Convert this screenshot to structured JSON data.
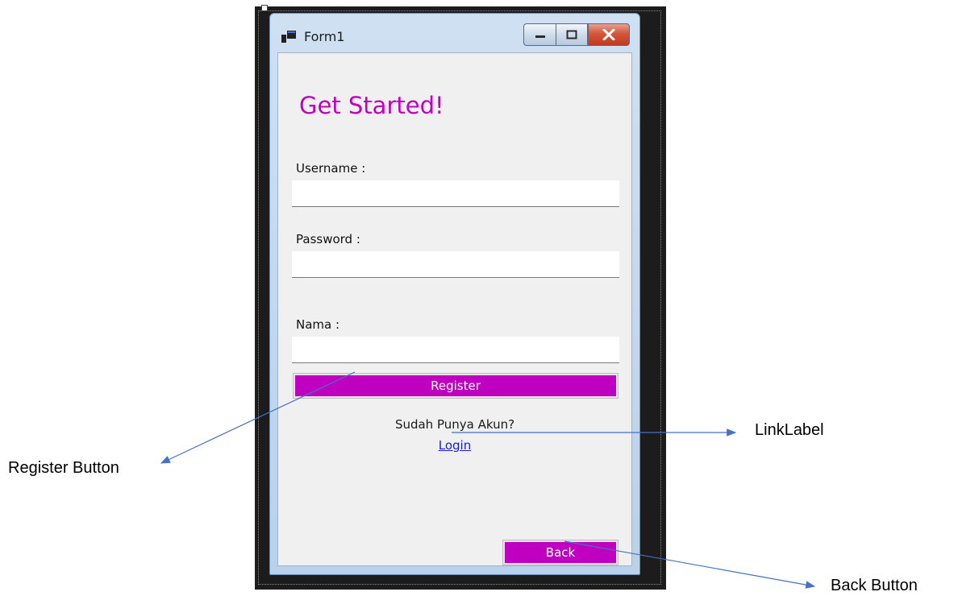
{
  "window": {
    "title": "Form1",
    "icon": "winforms-app-icon",
    "controls": {
      "minimize": "minimize-icon",
      "maximize": "maximize-icon",
      "close": "close-icon"
    }
  },
  "form": {
    "heading": "Get Started!",
    "fields": {
      "username": {
        "label": "Username :",
        "value": ""
      },
      "password": {
        "label": "Password :",
        "value": ""
      },
      "nama": {
        "label": "Nama :",
        "value": ""
      }
    },
    "register_label": "Register",
    "prompt_text": "Sudah Punya Akun?",
    "login_link": "Login",
    "back_label": "Back"
  },
  "annotations": {
    "register": "Register Button",
    "linklabel": "LinkLabel",
    "back": "Back Button"
  },
  "colors": {
    "accent": "#c000c0",
    "link": "#1a1adc",
    "arrow": "#4472c4"
  }
}
